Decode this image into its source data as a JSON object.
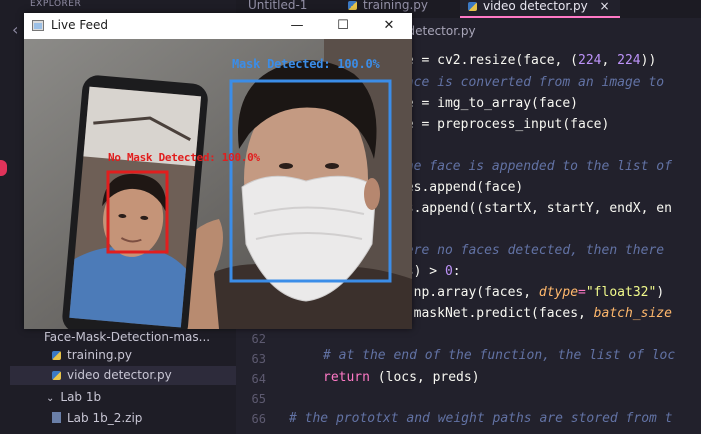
{
  "explorer": {
    "title": "EXPLORER",
    "items": [
      {
        "label": "Face-Mask-Detection-mas...",
        "kind": "folder-open"
      },
      {
        "label": "training.py",
        "kind": "py"
      },
      {
        "label": "video detector.py",
        "kind": "py",
        "active": true
      },
      {
        "label": "Lab 1b",
        "kind": "folder-open"
      },
      {
        "label": "Lab 1b_2.zip",
        "kind": "zip"
      }
    ]
  },
  "tabs": [
    {
      "label": "Untitled-1"
    },
    {
      "label": "training.py"
    },
    {
      "label": "video detector.py",
      "active": true,
      "close": "×"
    }
  ],
  "breadcrumb": "sk-Detection-master  ›  video detector.py",
  "code": {
    "visible_lines": [
      {
        "text": "ce = cv2.resize(face, (224, 224))"
      },
      {
        "text": "face is converted from an image to"
      },
      {
        "text": "ce = img_to_array(face)"
      },
      {
        "text": "ce = preprocess_input(face)"
      },
      {
        "text": "the face is appended to the list of"
      },
      {
        "text": "ces.append(face)"
      },
      {
        "text": "cs.append((startX, startY, endX, en"
      },
      {
        "text": "were no faces detected, then there"
      },
      {
        "text": "es) > 0:"
      },
      {
        "text": "= np.array(faces, dtype=\"float32\")"
      },
      {
        "text": "= maskNet.predict(faces, batch_size"
      },
      {
        "text": "# at the end of the function, the list of loc"
      },
      {
        "text": "return (locs, preds)"
      },
      {
        "text": "# the prototxt and weight paths are stored from t"
      }
    ],
    "line_numbers": [
      "62",
      "63",
      "64",
      "65",
      "66"
    ]
  },
  "live_feed": {
    "title": "Live Feed",
    "min_glyph": "—",
    "max_glyph": "☐",
    "close_glyph": "✕",
    "mask_label": "Mask Detected: 100.0%",
    "nomask_label": "No Mask Detected: 100.0%",
    "mask_color": "#3b8de8",
    "nomask_color": "#e11e1e"
  }
}
